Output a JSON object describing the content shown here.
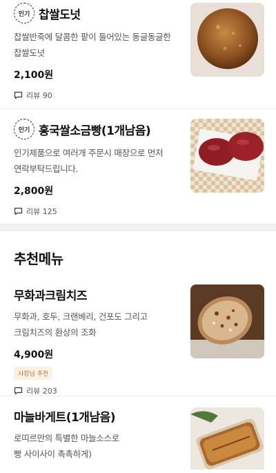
{
  "items_top": [
    {
      "badge": "인기",
      "name": "찹쌀도넛",
      "desc1": "찹쌀반죽에 달콤한 팥이 들어있는 동글동글한",
      "desc2": "찹쌀도넛",
      "price": "2,100원",
      "review": "리뷰 90"
    },
    {
      "badge": "인기",
      "name": "홍국쌀소금빵(1개남음)",
      "desc1": "인기제품으로 여러개 주문시 매장으로 먼저",
      "desc2": "연락부탁드립니다.",
      "price": "2,800원",
      "review": "리뷰 125"
    }
  ],
  "section": {
    "title": "추천메뉴"
  },
  "items_rec": [
    {
      "name": "무화과크림치즈",
      "desc1": "무화과, 호두, 크랜베리, 건포도 그리고",
      "desc2": "크림치즈의 환상의 조화",
      "price": "4,900원",
      "tag": "사장님 추천",
      "review": "리뷰 203"
    },
    {
      "name": "마늘바게트(1개남음)",
      "desc1": "로띠르만의 특별한 마늘소스로",
      "desc2": "빵 사이사이 촉촉하게)"
    }
  ],
  "icons": {
    "review": "speech-bubble-icon",
    "popular": "popular-badge"
  },
  "colors": {
    "tag_text": "#b07a3a",
    "tag_bg": "#fbf1e5"
  }
}
